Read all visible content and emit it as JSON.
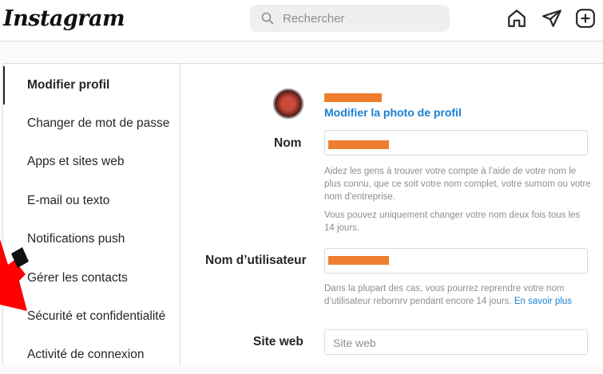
{
  "header": {
    "logo": "Instagram",
    "search_placeholder": "Rechercher",
    "icons": [
      "home-icon",
      "send-icon",
      "new-post-icon"
    ]
  },
  "sidebar": {
    "items": [
      {
        "label": "Modifier profil",
        "active": true
      },
      {
        "label": "Changer de mot de passe"
      },
      {
        "label": "Apps et sites web"
      },
      {
        "label": "E-mail ou texto"
      },
      {
        "label": "Notifications push"
      },
      {
        "label": "Gérer les contacts"
      },
      {
        "label": "Sécurité et confidentialité"
      },
      {
        "label": "Activité de connexion"
      }
    ]
  },
  "profile": {
    "change_photo": "Modifier la photo de profil"
  },
  "form": {
    "name_label": "Nom",
    "name_help_1": "Aidez les gens à trouver votre compte à l’aide de votre nom le plus connu, que ce soit votre nom complet, votre surnom ou votre nom d’entreprise.",
    "name_help_2": "Vous pouvez uniquement changer votre nom deux fois tous les 14 jours.",
    "username_label": "Nom d’utilisateur",
    "username_help_prefix": "Dans la plupart des cas, vous pourrez reprendre votre nom d’utilisateur rebornrv pendant encore 14 jours. ",
    "username_help_link": "En savoir plus",
    "website_label": "Site web",
    "website_placeholder": "Site web"
  },
  "colors": {
    "link": "#1a7fd1",
    "redaction": "#ef7d2e",
    "annotation_arrow": "#ff0000"
  }
}
